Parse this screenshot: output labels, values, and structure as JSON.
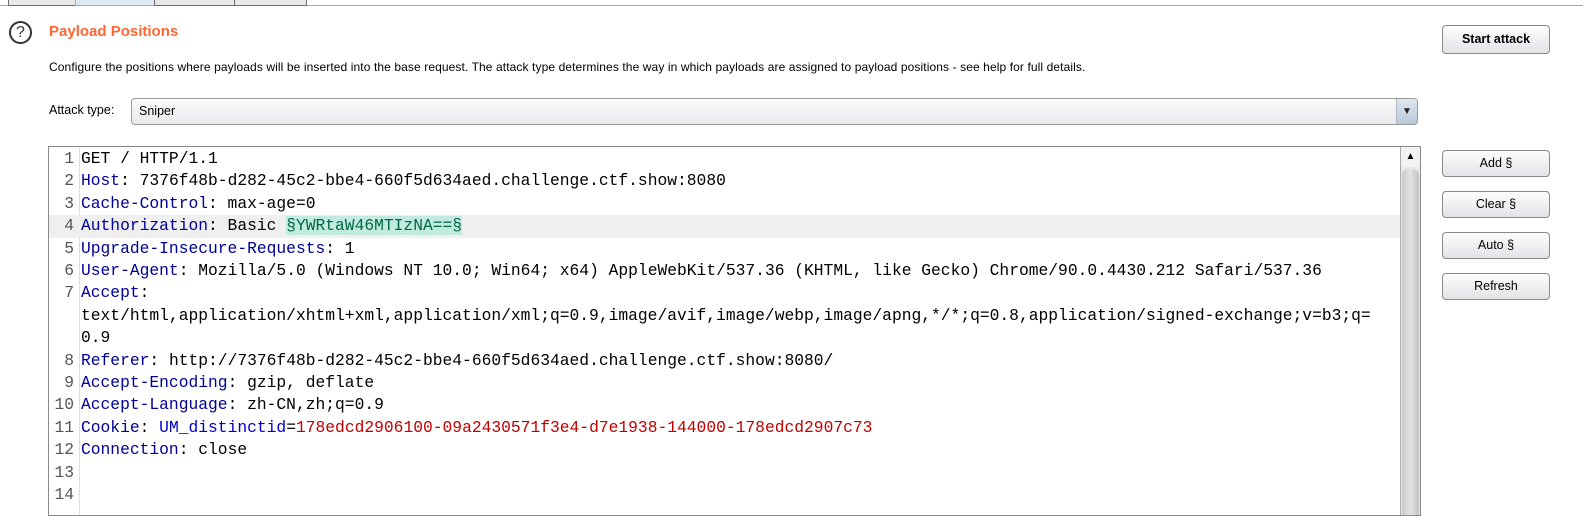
{
  "header": {
    "tabs": [
      "",
      "",
      "",
      ""
    ],
    "selected_tab": 1,
    "title": "Payload Positions",
    "description": "Configure the positions where payloads will be inserted into the base request. The attack type determines the way in which payloads are assigned to payload positions - see help for full details.",
    "start_attack": "Start attack",
    "help_icon": "?"
  },
  "attack_type": {
    "label": "Attack type:",
    "value": "Sniper"
  },
  "side_buttons": {
    "add": "Add §",
    "clear": "Clear §",
    "auto": "Auto §",
    "refresh": "Refresh"
  },
  "colors": {
    "title": "#ff6633",
    "header_name": "#000099",
    "cookie_value": "#c00000",
    "payload_bg": "#c2ebdf"
  },
  "request": {
    "highlighted_line": 4,
    "lines": [
      [
        {
          "t": "GET / HTTP/1.1",
          "s": ""
        }
      ],
      [
        {
          "t": "Host",
          "s": "k"
        },
        {
          "t": ": 7376f48b-d282-45c2-bbe4-660f5d634aed.challenge.ctf.show:8080",
          "s": ""
        }
      ],
      [
        {
          "t": "Cache-Control",
          "s": "k"
        },
        {
          "t": ": max-age=0",
          "s": ""
        }
      ],
      [
        {
          "t": "Authorization",
          "s": "k"
        },
        {
          "t": ": Basic ",
          "s": ""
        },
        {
          "t": "§YWRtaW46MTIzNA==§",
          "s": "pl"
        }
      ],
      [
        {
          "t": "Upgrade-Insecure-Requests",
          "s": "k"
        },
        {
          "t": ": 1",
          "s": ""
        }
      ],
      [
        {
          "t": "User-Agent",
          "s": "k"
        },
        {
          "t": ": Mozilla/5.0 (Windows NT 10.0; Win64; x64) AppleWebKit/537.36 (KHTML, like Gecko) Chrome/90.0.4430.212 Safari/537.36",
          "s": ""
        }
      ],
      [
        {
          "t": "Accept",
          "s": "k"
        },
        {
          "t": ":\ntext/html,application/xhtml+xml,application/xml;q=0.9,image/avif,image/webp,image/apng,*/*;q=0.8,application/signed-exchange;v=b3;q=\n0.9",
          "s": ""
        }
      ],
      [
        {
          "t": "Referer",
          "s": "k"
        },
        {
          "t": ": http://7376f48b-d282-45c2-bbe4-660f5d634aed.challenge.ctf.show:8080/",
          "s": ""
        }
      ],
      [
        {
          "t": "Accept-Encoding",
          "s": "k"
        },
        {
          "t": ": gzip, deflate",
          "s": ""
        }
      ],
      [
        {
          "t": "Accept-Language",
          "s": "k"
        },
        {
          "t": ": zh-CN,zh;q=0.9",
          "s": ""
        }
      ],
      [
        {
          "t": "Cookie",
          "s": "k"
        },
        {
          "t": ": ",
          "s": ""
        },
        {
          "t": "UM_distinctid",
          "s": "ck"
        },
        {
          "t": "=",
          "s": ""
        },
        {
          "t": "178edcd2906100-09a2430571f3e4-d7e1938-144000-178edcd2907c73",
          "s": "cv"
        }
      ],
      [
        {
          "t": "Connection",
          "s": "k"
        },
        {
          "t": ": close",
          "s": ""
        }
      ],
      [],
      []
    ]
  }
}
